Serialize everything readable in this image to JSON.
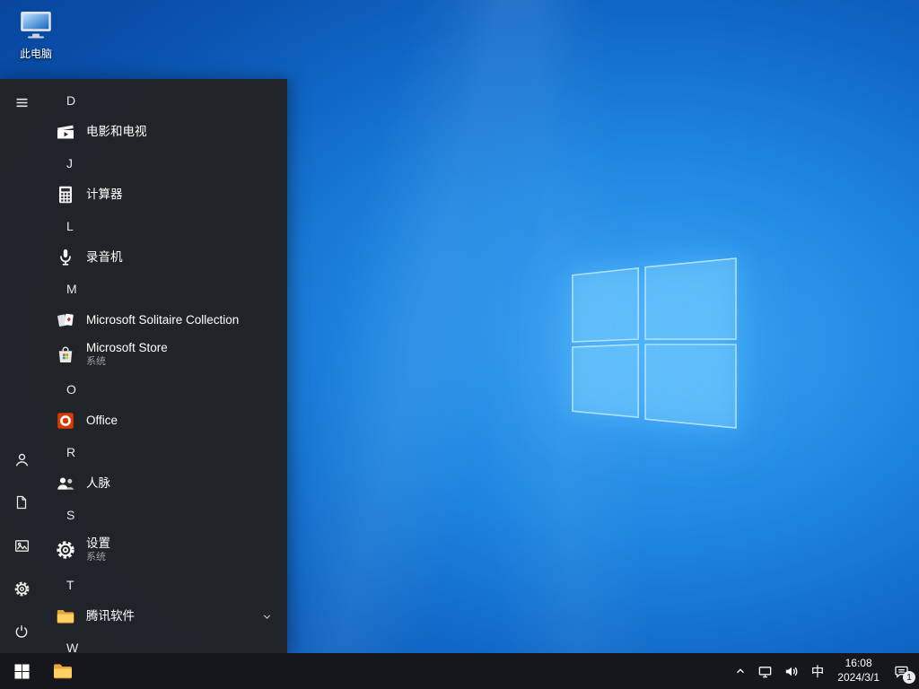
{
  "desktop": {
    "icons": [
      {
        "label": "此电脑",
        "icon": "this-pc-icon"
      }
    ]
  },
  "start_menu": {
    "rail": {
      "top": [
        {
          "name": "menu",
          "icon": "hamburger-icon"
        }
      ],
      "bottom": [
        {
          "name": "user",
          "icon": "user-icon"
        },
        {
          "name": "documents",
          "icon": "document-icon"
        },
        {
          "name": "pictures",
          "icon": "pictures-icon"
        },
        {
          "name": "settings",
          "icon": "gear-icon"
        },
        {
          "name": "power",
          "icon": "power-icon"
        }
      ]
    },
    "sections": [
      {
        "letter": "D",
        "apps": [
          {
            "label": "电影和电视",
            "icon": "movies-tv-icon"
          }
        ]
      },
      {
        "letter": "J",
        "apps": [
          {
            "label": "计算器",
            "icon": "calculator-icon"
          }
        ]
      },
      {
        "letter": "L",
        "apps": [
          {
            "label": "录音机",
            "icon": "voice-recorder-icon"
          }
        ]
      },
      {
        "letter": "M",
        "apps": [
          {
            "label": "Microsoft Solitaire Collection",
            "icon": "solitaire-icon"
          },
          {
            "label": "Microsoft Store",
            "sublabel": "系统",
            "icon": "store-icon"
          }
        ]
      },
      {
        "letter": "O",
        "apps": [
          {
            "label": "Office",
            "icon": "office-icon"
          }
        ]
      },
      {
        "letter": "R",
        "apps": [
          {
            "label": "人脉",
            "icon": "people-icon"
          }
        ]
      },
      {
        "letter": "S",
        "apps": [
          {
            "label": "设置",
            "sublabel": "系统",
            "icon": "settings-gear-icon"
          }
        ]
      },
      {
        "letter": "T",
        "apps": [
          {
            "label": "腾讯软件",
            "icon": "folder-icon",
            "expandable": true
          }
        ]
      },
      {
        "letter": "W",
        "apps": []
      }
    ]
  },
  "taskbar": {
    "start_icon": "windows-start-icon",
    "pinned": [
      {
        "name": "file-explorer",
        "icon": "file-explorer-icon"
      }
    ],
    "tray": {
      "ime": "中",
      "time": "16:08",
      "date": "2024/3/1",
      "notification_count": "1"
    }
  },
  "colors": {
    "accent_blue": "#0078d7",
    "menu_bg": "#212326",
    "taskbar_bg": "#16171c",
    "folder_yellow": "#ffd064",
    "office_orange": "#d83b01",
    "store_red": "#f25022",
    "store_green": "#7fba00",
    "store_blue": "#00a4ef",
    "store_yellow": "#ffb900"
  }
}
